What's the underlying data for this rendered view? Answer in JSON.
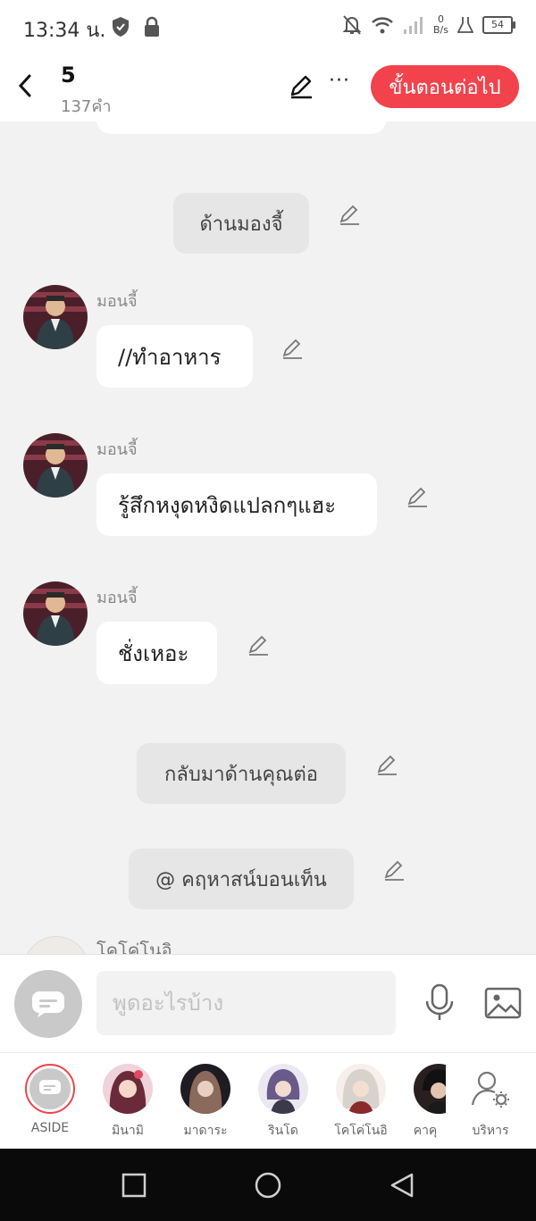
{
  "status": {
    "time": "13:34 น.",
    "net_speed_top": "0",
    "net_speed_bottom": "B/s",
    "battery": "54"
  },
  "header": {
    "title": "5",
    "subtitle": "137คำ",
    "next_label": "ขั้นตอนต่อไป",
    "more_label": "···"
  },
  "messages": {
    "n1": "ด้านมองจี้",
    "m1_speaker": "มอนจี้",
    "m1_text": "//ทำอาหาร",
    "m2_speaker": "มอนจี้",
    "m2_text": "รู้สึกหงุดหงิดแปลกๆแฮะ",
    "m3_speaker": "มอนจี้",
    "m3_text": "ชั่งเหอะ",
    "n2": "กลับมาด้านคุณต่อ",
    "n3": "@ คฤหาสน์บอนเท็น",
    "peek_speaker": "โคโค่โนอิ"
  },
  "input": {
    "placeholder": "พูดอะไรบ้าง"
  },
  "characters": [
    {
      "label": "ASIDE"
    },
    {
      "label": "มินามิ"
    },
    {
      "label": "มาดาระ"
    },
    {
      "label": "รินโด"
    },
    {
      "label": "โคโค่โนอิ"
    },
    {
      "label": "คาคุ"
    },
    {
      "label": "บริหาร"
    }
  ],
  "colors": {
    "accent": "#f2434c",
    "bubble": "#ffffff",
    "narration": "#e6e6e6",
    "background": "#f2f2f2"
  }
}
